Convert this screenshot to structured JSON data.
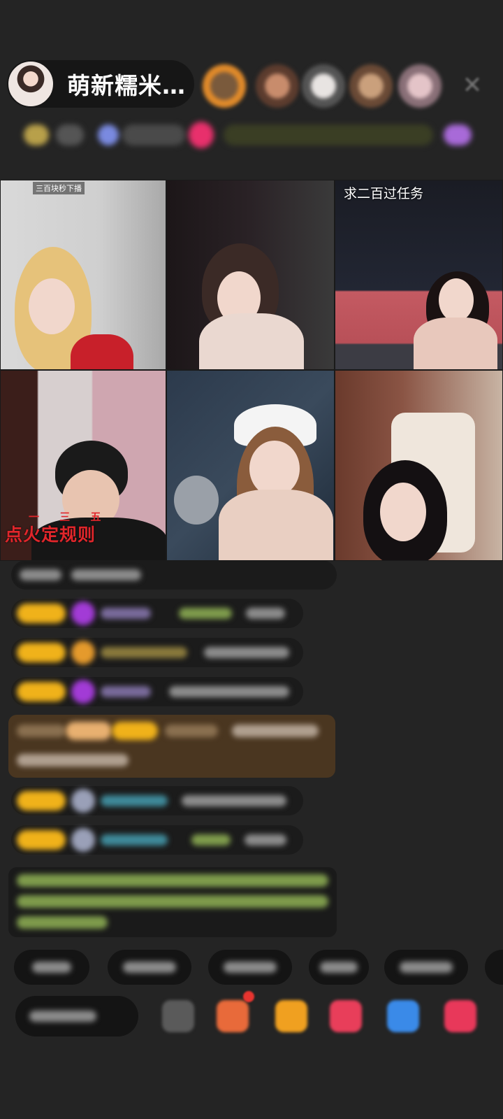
{
  "header": {
    "host_name": "萌新糯米…",
    "close_icon": "close-icon"
  },
  "video_grid": {
    "cells": [
      {
        "label": "三百块秒下播"
      },
      {
        "label": ""
      },
      {
        "label": "求二百过任务"
      },
      {
        "label": "点火定规则",
        "label_top": "一 三 五"
      },
      {
        "label": ""
      },
      {
        "label": ""
      }
    ]
  },
  "colors": {
    "background": "#242424",
    "pill": "#161616",
    "badge_gold": "#f0b21a",
    "overlay_red": "#e0262b",
    "notification_dot": "#e8342f"
  }
}
